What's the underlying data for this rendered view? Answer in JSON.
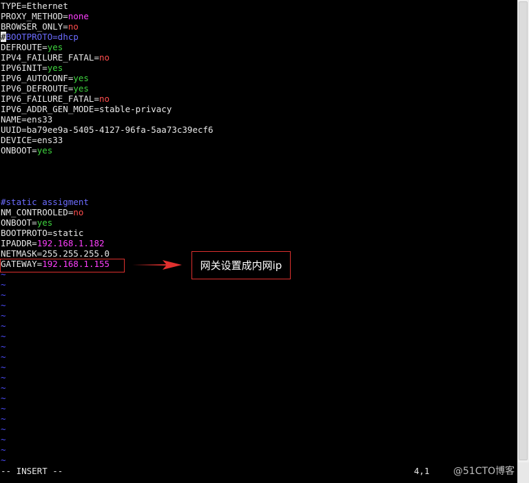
{
  "config_lines": [
    {
      "key": "TYPE=",
      "value": "Ethernet",
      "color": "plain"
    },
    {
      "key": "PROXY_METHOD=",
      "value": "none",
      "color": "magenta"
    },
    {
      "key": "BROWSER_ONLY=",
      "value": "no",
      "color": "red"
    },
    {
      "cursor": "#",
      "key": "BOOTPROTO=",
      "value": "dhcp",
      "color": "blue",
      "key_color": "blue"
    },
    {
      "key": "DEFROUTE=",
      "value": "yes",
      "color": "green"
    },
    {
      "key": "IPV4_FAILURE_FATAL=",
      "value": "no",
      "color": "red"
    },
    {
      "key": "IPV6INIT=",
      "value": "yes",
      "color": "green"
    },
    {
      "key": "IPV6_AUTOCONF=",
      "value": "yes",
      "color": "green"
    },
    {
      "key": "IPV6_DEFROUTE=",
      "value": "yes",
      "color": "green"
    },
    {
      "key": "IPV6_FAILURE_FATAL=",
      "value": "no",
      "color": "red"
    },
    {
      "key": "IPV6_ADDR_GEN_MODE=",
      "value": "stable-privacy",
      "color": "plain"
    },
    {
      "key": "NAME=",
      "value": "ens33",
      "color": "plain"
    },
    {
      "key": "UUID=",
      "value": "ba79ee9a-5405-4127-96fa-5aa73c39ecf6",
      "color": "plain"
    },
    {
      "key": "DEVICE=",
      "value": "ens33",
      "color": "plain"
    },
    {
      "key": "ONBOOT=",
      "value": "yes",
      "color": "green"
    }
  ],
  "static_lines": [
    {
      "key": "",
      "value": "#static assigment",
      "color": "blue"
    },
    {
      "key": "NM_CONTROOLED=",
      "value": "no",
      "color": "red"
    },
    {
      "key": "ONBOOT=",
      "value": "yes",
      "color": "green"
    },
    {
      "key": "BOOTPROTO=",
      "value": "static",
      "color": "plain"
    },
    {
      "key": "IPADDR=",
      "value": "192.168.1.182",
      "color": "magenta"
    },
    {
      "key": "NETMASK=",
      "value": "255.255.255.0",
      "color": "plain"
    },
    {
      "key": "GATEWAY=",
      "value": "192.168.1.155",
      "color": "magenta"
    }
  ],
  "tilde_char": "~",
  "status": {
    "mode": "-- INSERT --",
    "position": "4,1"
  },
  "annotation": {
    "text": "网关设置成内网ip"
  },
  "watermark": "@51CTO博客",
  "colors": {
    "green": "#3fd43f",
    "red": "#ff4d4d",
    "magenta": "#ff3fff",
    "blue": "#6c6cff",
    "tilde": "#4e4eff",
    "annotation_border": "#e0312f"
  }
}
